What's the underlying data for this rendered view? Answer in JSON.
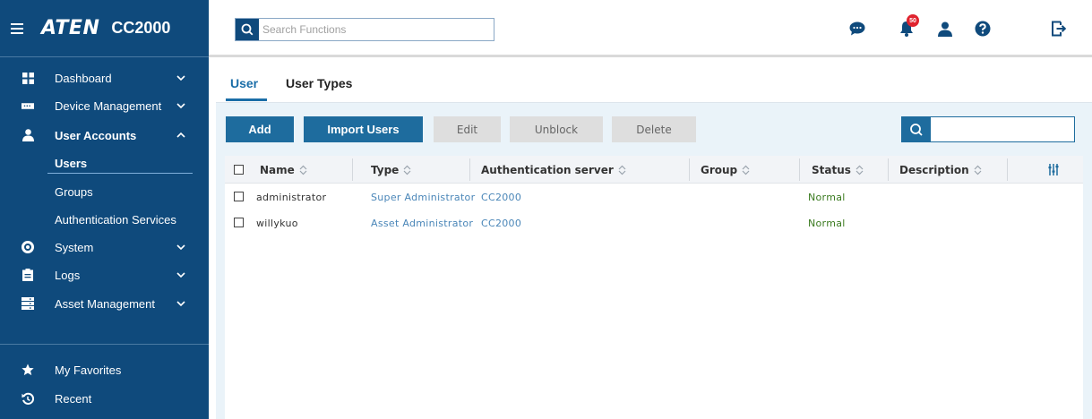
{
  "app": {
    "logo": "ATEN",
    "model": "CC2000"
  },
  "topbar": {
    "search_placeholder": "Search Functions",
    "notification_count": "50"
  },
  "sidebar": {
    "items": [
      {
        "label": "Dashboard",
        "icon": "grid-icon"
      },
      {
        "label": "Device Management",
        "icon": "device-icon"
      },
      {
        "label": "User Accounts",
        "icon": "user-icon"
      },
      {
        "label": "Users"
      },
      {
        "label": "Groups"
      },
      {
        "label": "Authentication Services"
      },
      {
        "label": "System",
        "icon": "gear-icon"
      },
      {
        "label": "Logs",
        "icon": "clipboard-icon"
      },
      {
        "label": "Asset Management",
        "icon": "asset-icon"
      },
      {
        "label": "My Favorites",
        "icon": "star-icon"
      },
      {
        "label": "Recent",
        "icon": "history-icon"
      }
    ]
  },
  "tabs": {
    "user": "User",
    "user_types": "User Types"
  },
  "toolbar": {
    "add": "Add",
    "import_users": "Import Users",
    "edit": "Edit",
    "unblock": "Unblock",
    "delete": "Delete",
    "search_value": ""
  },
  "table": {
    "columns": [
      "Name",
      "Type",
      "Authentication server",
      "Group",
      "Status",
      "Description"
    ],
    "rows": [
      {
        "name": "administrator",
        "type": "Super Administrator",
        "auth": "CC2000",
        "group": "",
        "status": "Normal",
        "description": ""
      },
      {
        "name": "willykuo",
        "type": "Asset Administrator",
        "auth": "CC2000",
        "group": "",
        "status": "Normal",
        "description": ""
      }
    ]
  },
  "colors": {
    "sidebar_bg": "#0f4a7c",
    "primary": "#1e6c9e",
    "link": "#4a86b8",
    "status_normal": "#3a7a1f",
    "badge": "#e0242f"
  }
}
